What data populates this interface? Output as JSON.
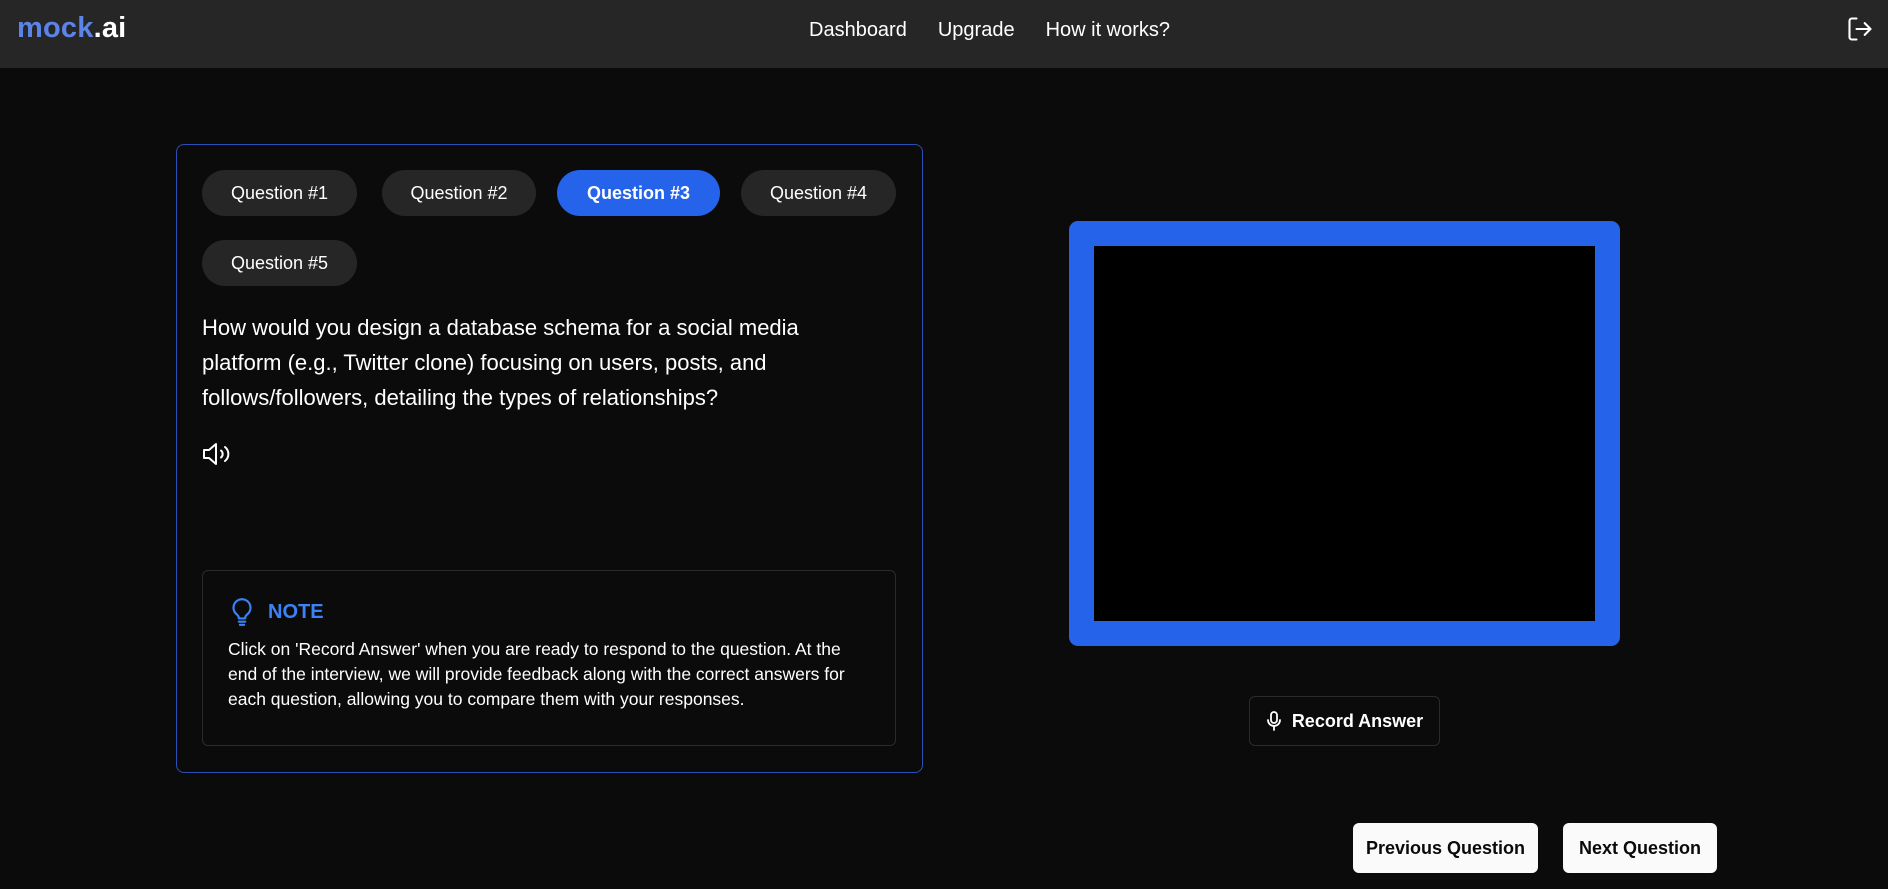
{
  "header": {
    "logo_brand": "mock",
    "logo_tld": ".ai",
    "nav": [
      "Dashboard",
      "Upgrade",
      "How it works?"
    ],
    "logout_icon": "logout-icon"
  },
  "questions": {
    "tabs": [
      "Question #1",
      "Question #2",
      "Question #3",
      "Question #4",
      "Question #5"
    ],
    "active_index": 2,
    "text": "How would you design a database schema for a social media platform (e.g., Twitter clone) focusing on users, posts, and follows/followers, detailing the types of relationships?",
    "speaker_icon": "speaker-icon"
  },
  "note": {
    "icon": "lightbulb-icon",
    "title": "NOTE",
    "text": "Click on 'Record Answer' when you are ready to respond to the question. At the end of the interview, we will provide feedback along with the correct answers for each question, allowing you to compare them with your responses."
  },
  "video": {
    "border_color": "#2563eb"
  },
  "actions": {
    "record_label": "Record Answer",
    "record_icon": "microphone-icon",
    "previous_label": "Previous Question",
    "next_label": "Next Question"
  },
  "colors": {
    "accent": "#2563eb",
    "logo_accent": "#5c83e6",
    "note_title": "#3b82f6",
    "nav_bg": "#262626",
    "page_bg": "#0b0b0b"
  }
}
